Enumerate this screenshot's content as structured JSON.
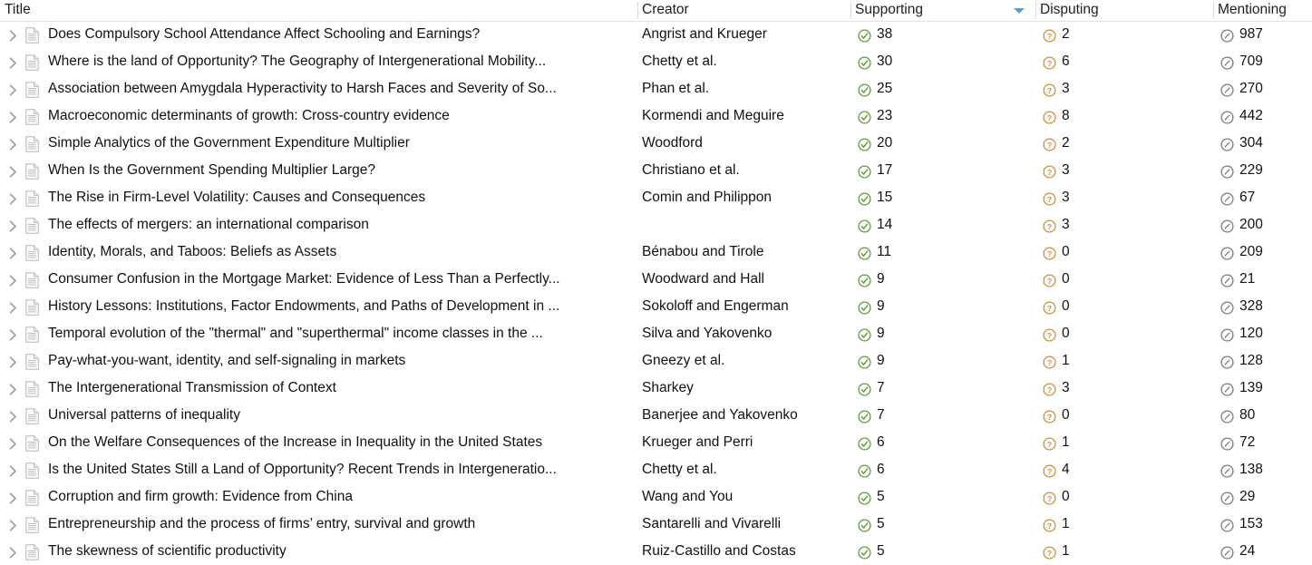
{
  "table": {
    "columns": [
      {
        "key": "title",
        "label": "Title"
      },
      {
        "key": "creator",
        "label": "Creator"
      },
      {
        "key": "supporting",
        "label": "Supporting"
      },
      {
        "key": "disputing",
        "label": "Disputing"
      },
      {
        "key": "mentioning",
        "label": "Mentioning"
      }
    ],
    "sort": {
      "column": "Supporting",
      "direction": "descending",
      "indicator_icon": "sort-descending-triangle-icon"
    },
    "icons": {
      "expand": "chevron-right-icon",
      "document": "document-icon",
      "supporting": "check-circle-icon",
      "disputing": "question-circle-icon",
      "mentioning": "slash-circle-icon"
    },
    "colors": {
      "supporting": "#5aa02c",
      "disputing": "#e08a1e",
      "mentioning": "#7a7a7a",
      "sort_indicator": "#4a9fe0",
      "header_text": "#202020",
      "row_text": "#111111",
      "divider": "#dadada"
    },
    "rows": [
      {
        "title": "Does Compulsory School Attendance Affect Schooling and Earnings?",
        "creator": "Angrist and Krueger",
        "supporting": "38",
        "disputing": "2",
        "mentioning": "987"
      },
      {
        "title": "Where is the land of Opportunity? The Geography of Intergenerational Mobility...",
        "creator": "Chetty et al.",
        "supporting": "30",
        "disputing": "6",
        "mentioning": "709"
      },
      {
        "title": "Association between Amygdala Hyperactivity to Harsh Faces and Severity of So...",
        "creator": "Phan et al.",
        "supporting": "25",
        "disputing": "3",
        "mentioning": "270"
      },
      {
        "title": "Macroeconomic determinants of growth: Cross-country evidence",
        "creator": "Kormendi and Meguire",
        "supporting": "23",
        "disputing": "8",
        "mentioning": "442"
      },
      {
        "title": "Simple Analytics of the Government Expenditure Multiplier",
        "creator": "Woodford",
        "supporting": "20",
        "disputing": "2",
        "mentioning": "304"
      },
      {
        "title": "When Is the Government Spending Multiplier Large?",
        "creator": "Christiano et al.",
        "supporting": "17",
        "disputing": "3",
        "mentioning": "229"
      },
      {
        "title": "The Rise in Firm-Level Volatility: Causes and Consequences",
        "creator": "Comin and Philippon",
        "supporting": "15",
        "disputing": "3",
        "mentioning": "67"
      },
      {
        "title": "The effects of mergers: an international comparison",
        "creator": "",
        "supporting": "14",
        "disputing": "3",
        "mentioning": "200"
      },
      {
        "title": "Identity, Morals, and Taboos: Beliefs as Assets",
        "creator": "Bénabou and Tirole",
        "supporting": "11",
        "disputing": "0",
        "mentioning": "209"
      },
      {
        "title": "Consumer Confusion in the Mortgage Market: Evidence of Less Than a Perfectly...",
        "creator": "Woodward and Hall",
        "supporting": "9",
        "disputing": "0",
        "mentioning": "21"
      },
      {
        "title": "History Lessons: Institutions, Factor Endowments, and Paths of Development in ...",
        "creator": "Sokoloff and Engerman",
        "supporting": "9",
        "disputing": "0",
        "mentioning": "328"
      },
      {
        "title": "Temporal evolution of the \"thermal\" and \"superthermal\" income classes in the ...",
        "creator": "Silva and Yakovenko",
        "supporting": "9",
        "disputing": "0",
        "mentioning": "120"
      },
      {
        "title": "Pay-what-you-want, identity, and self-signaling in markets",
        "creator": "Gneezy et al.",
        "supporting": "9",
        "disputing": "1",
        "mentioning": "128"
      },
      {
        "title": "The Intergenerational Transmission of Context",
        "creator": "Sharkey",
        "supporting": "7",
        "disputing": "3",
        "mentioning": "139"
      },
      {
        "title": "Universal patterns of inequality",
        "creator": "Banerjee and Yakovenko",
        "supporting": "7",
        "disputing": "0",
        "mentioning": "80"
      },
      {
        "title": "On the Welfare Consequences of the Increase in Inequality in the United States",
        "creator": "Krueger and Perri",
        "supporting": "6",
        "disputing": "1",
        "mentioning": "72"
      },
      {
        "title": "Is the United States Still a Land of Opportunity? Recent Trends in Intergeneratio...",
        "creator": "Chetty et al.",
        "supporting": "6",
        "disputing": "4",
        "mentioning": "138"
      },
      {
        "title": "Corruption and firm growth: Evidence from China",
        "creator": "Wang and You",
        "supporting": "5",
        "disputing": "0",
        "mentioning": "29"
      },
      {
        "title": "Entrepreneurship and the process of firms’ entry, survival and growth",
        "creator": "Santarelli and Vivarelli",
        "supporting": "5",
        "disputing": "1",
        "mentioning": "153"
      },
      {
        "title": "The skewness of scientific productivity",
        "creator": "Ruiz-Castillo and Costas",
        "supporting": "5",
        "disputing": "1",
        "mentioning": "24"
      }
    ]
  }
}
